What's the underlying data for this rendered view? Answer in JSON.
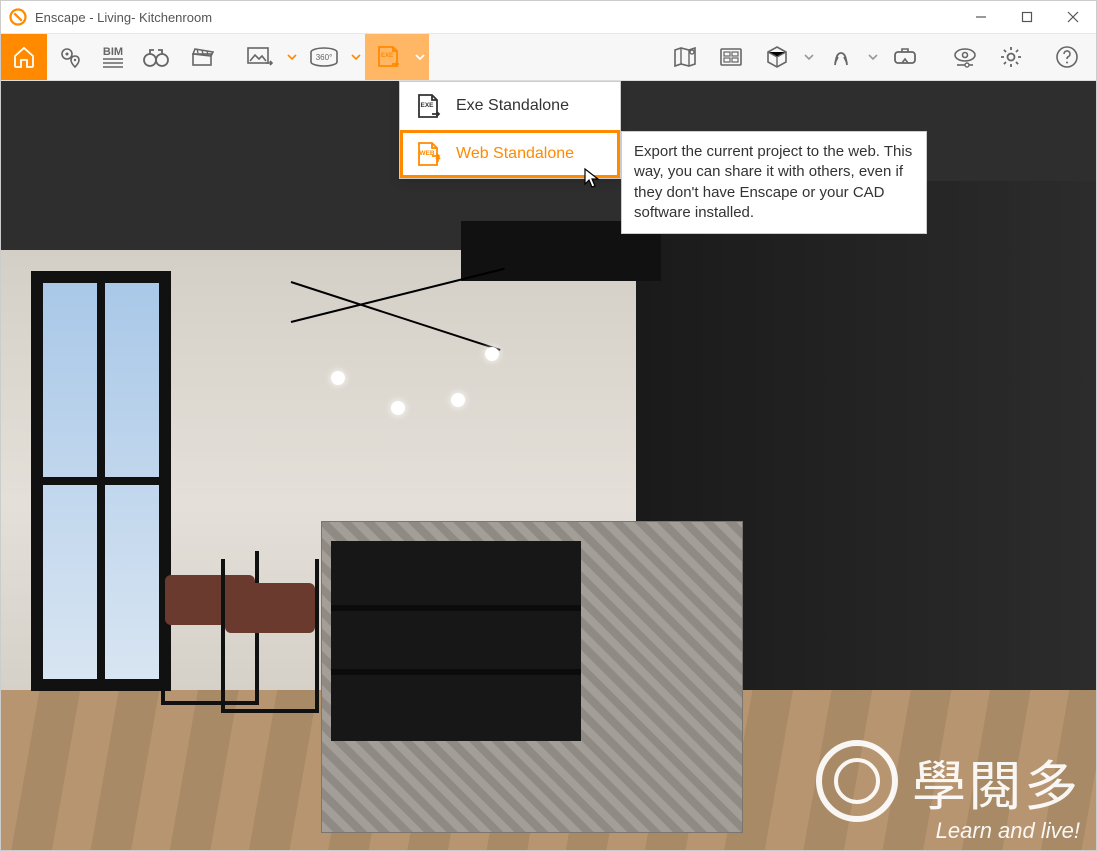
{
  "window": {
    "title": "Enscape - Living- Kitchenroom"
  },
  "toolbar": {
    "bim_label": "BIM",
    "panorama_label": "360°",
    "exe_badge": "EXE"
  },
  "dropdown": {
    "items": [
      {
        "icon_badge": "EXE",
        "label": "Exe Standalone"
      },
      {
        "icon_badge": "WEB",
        "label": "Web Standalone"
      }
    ],
    "selected_index": 1
  },
  "tooltip": {
    "text": "Export the current project to the web. This way, you can share it with others, even if they don't have Enscape or your CAD software installed."
  },
  "watermark": {
    "brand": "學閱多",
    "tagline": "Learn and live!"
  }
}
